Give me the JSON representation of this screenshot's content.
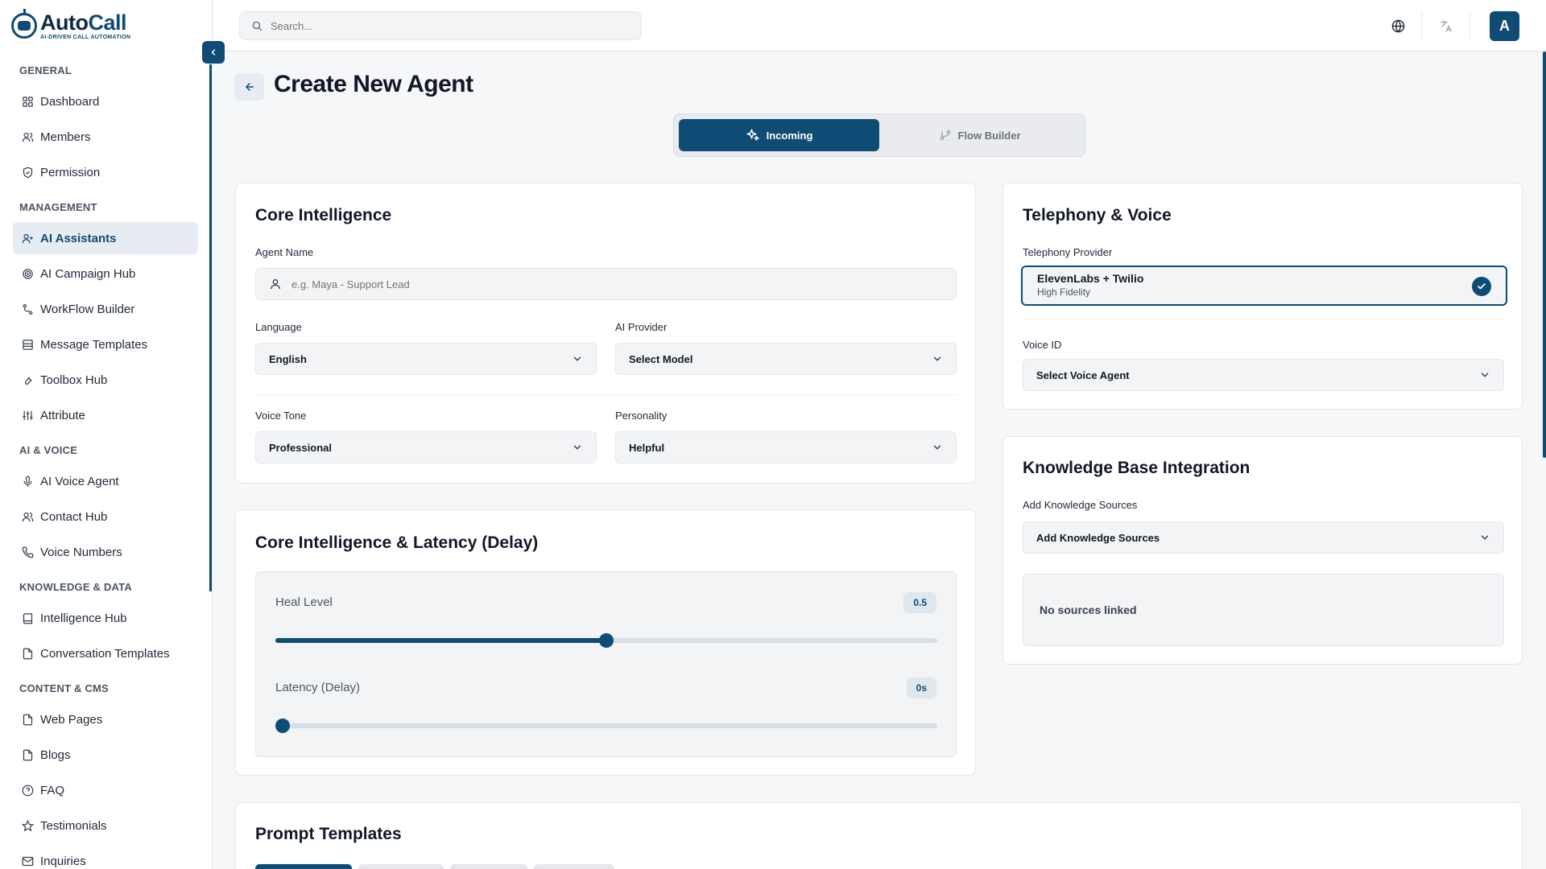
{
  "brand": {
    "name_part1": "Auto",
    "name_part2": "Call",
    "tagline": "AI-DRIVEN CALL AUTOMATION"
  },
  "search": {
    "placeholder": "Search..."
  },
  "user": {
    "initial": "A"
  },
  "sidebar": {
    "sections": [
      {
        "title": "GENERAL",
        "items": [
          {
            "label": "Dashboard",
            "icon": "grid-icon"
          },
          {
            "label": "Members",
            "icon": "users-icon"
          },
          {
            "label": "Permission",
            "icon": "shield-icon"
          }
        ]
      },
      {
        "title": "MANAGEMENT",
        "items": [
          {
            "label": "AI Assistants",
            "icon": "user-plus-icon",
            "active": true
          },
          {
            "label": "AI Campaign Hub",
            "icon": "target-icon"
          },
          {
            "label": "WorkFlow Builder",
            "icon": "workflow-icon"
          },
          {
            "label": "Message Templates",
            "icon": "layout-icon"
          },
          {
            "label": "Toolbox Hub",
            "icon": "wrench-icon"
          },
          {
            "label": "Attribute",
            "icon": "sliders-icon"
          }
        ]
      },
      {
        "title": "AI & VOICE",
        "items": [
          {
            "label": "AI Voice Agent",
            "icon": "mic-icon"
          },
          {
            "label": "Contact Hub",
            "icon": "users-icon"
          },
          {
            "label": "Voice Numbers",
            "icon": "phone-icon"
          }
        ]
      },
      {
        "title": "KNOWLEDGE & DATA",
        "items": [
          {
            "label": "Intelligence Hub",
            "icon": "book-icon"
          },
          {
            "label": "Conversation Templates",
            "icon": "file-icon"
          }
        ]
      },
      {
        "title": "CONTENT & CMS",
        "items": [
          {
            "label": "Web Pages",
            "icon": "file-icon"
          },
          {
            "label": "Blogs",
            "icon": "file-icon"
          },
          {
            "label": "FAQ",
            "icon": "help-icon"
          },
          {
            "label": "Testimonials",
            "icon": "star-icon"
          },
          {
            "label": "Inquiries",
            "icon": "mail-icon"
          }
        ]
      }
    ]
  },
  "page": {
    "title": "Create New Agent"
  },
  "mode_tabs": [
    {
      "label": "Incoming",
      "active": true
    },
    {
      "label": "Flow Builder",
      "active": false
    }
  ],
  "core_intelligence": {
    "title": "Core Intelligence",
    "agent_name_label": "Agent Name",
    "agent_name_placeholder": "e.g. Maya - Support Lead",
    "agent_name_value": "",
    "language_label": "Language",
    "language_value": "English",
    "provider_label": "AI Provider",
    "provider_value": "Select Model",
    "tone_label": "Voice Tone",
    "tone_value": "Professional",
    "personality_label": "Personality",
    "personality_value": "Helpful"
  },
  "latency": {
    "title": "Core Intelligence & Latency (Delay)",
    "heal_label": "Heal Level",
    "heal_value_text": "0.5",
    "heal_fraction": 0.5,
    "delay_label": "Latency (Delay)",
    "delay_value_text": "0s",
    "delay_fraction": 0
  },
  "telephony": {
    "title": "Telephony & Voice",
    "provider_label": "Telephony Provider",
    "provider_name": "ElevenLabs + Twilio",
    "provider_sub": "High Fidelity",
    "voice_label": "Voice ID",
    "voice_value": "Select Voice Agent"
  },
  "knowledge": {
    "title": "Knowledge Base Integration",
    "sources_label": "Add Knowledge Sources",
    "sources_value": "Add Knowledge Sources",
    "empty_text": "No sources linked"
  },
  "prompts": {
    "title": "Prompt Templates"
  },
  "colors": {
    "primary": "#0f4c75",
    "accent_bg": "#e6ecf2"
  }
}
